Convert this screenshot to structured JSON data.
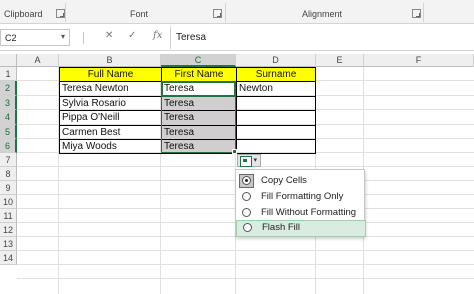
{
  "ribbon": {
    "groups": [
      "Clipboard",
      "Font",
      "Alignment"
    ]
  },
  "formula_bar": {
    "name_box": "C2",
    "fx_label": "fx",
    "cancel_glyph": "✕",
    "enter_glyph": "✓",
    "value": "Teresa"
  },
  "columns": [
    "A",
    "B",
    "C",
    "D",
    "E",
    "F"
  ],
  "rows": [
    "1",
    "2",
    "3",
    "4",
    "5",
    "6",
    "7",
    "8",
    "9",
    "10",
    "11",
    "12",
    "13",
    "14"
  ],
  "sheet": {
    "header": {
      "full_name": "Full Name",
      "first_name": "First Name",
      "surname": "Surname"
    },
    "data_rows": [
      {
        "full_name": "Teresa Newton",
        "first_name": "Teresa",
        "surname": "Newton"
      },
      {
        "full_name": "Sylvia Rosario",
        "first_name": "Teresa",
        "surname": ""
      },
      {
        "full_name": "Pippa O'Neill",
        "first_name": "Teresa",
        "surname": ""
      },
      {
        "full_name": "Carmen Best",
        "first_name": "Teresa",
        "surname": ""
      },
      {
        "full_name": "Miya Woods",
        "first_name": "Teresa",
        "surname": ""
      }
    ]
  },
  "autofill_menu": {
    "items": [
      {
        "label": "Copy Cells",
        "selected": true
      },
      {
        "label": "Fill Formatting Only",
        "selected": false
      },
      {
        "label": "Fill Without Formatting",
        "selected": false
      },
      {
        "label": "Flash Fill",
        "selected": false,
        "highlighted": true
      }
    ]
  },
  "colors": {
    "header_fill": "#ffff00",
    "filled_cells": "#d0cece",
    "excel_green": "#217346",
    "menu_highlight": "#d8ecdf"
  }
}
